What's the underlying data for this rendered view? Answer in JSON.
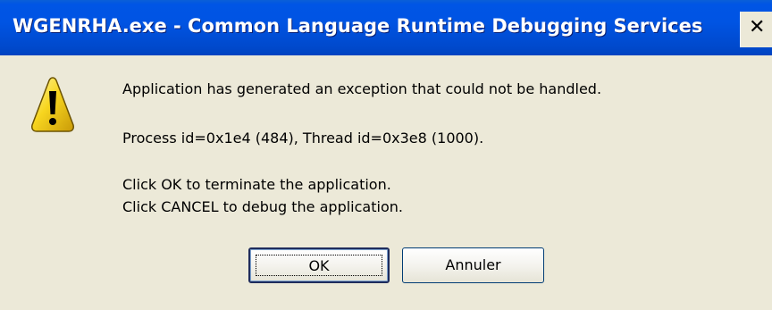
{
  "window": {
    "title": "WGENRHA.exe - Common Language Runtime Debugging Services",
    "close_glyph": "✕",
    "close_label": "x"
  },
  "dialog": {
    "icon": "warning-icon",
    "message_line1": "Application has generated an exception that could not be handled.",
    "message_line2": "Process id=0x1e4 (484), Thread id=0x3e8 (1000).",
    "message_line3": "Click OK to terminate the application.",
    "message_line4": "Click CANCEL to debug the application."
  },
  "buttons": {
    "ok_label": "OK",
    "cancel_label": "Annuler"
  },
  "colors": {
    "titlebar": "#0054e3",
    "body": "#ece9d8",
    "warning_fill": "#f7d51f"
  }
}
